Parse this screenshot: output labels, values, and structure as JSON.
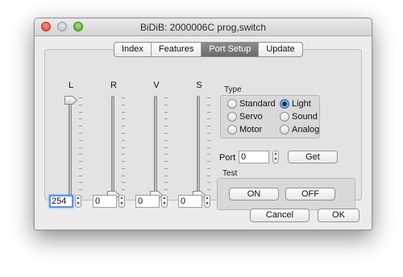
{
  "window": {
    "title": "BiDiB: 2000006C prog,switch"
  },
  "tabs": [
    {
      "label": "Index",
      "active": false
    },
    {
      "label": "Features",
      "active": false
    },
    {
      "label": "Port Setup",
      "active": true
    },
    {
      "label": "Update",
      "active": false
    }
  ],
  "sliders": [
    {
      "label": "L",
      "value": "254",
      "level": 1.0
    },
    {
      "label": "R",
      "value": "0",
      "level": 0.0
    },
    {
      "label": "V",
      "value": "0",
      "level": 0.0
    },
    {
      "label": "S",
      "value": "0",
      "level": 0.0
    }
  ],
  "type_group": {
    "label": "Type",
    "options": [
      {
        "label": "Standard",
        "selected": false
      },
      {
        "label": "Light",
        "selected": true
      },
      {
        "label": "Servo",
        "selected": false
      },
      {
        "label": "Sound",
        "selected": false
      },
      {
        "label": "Motor",
        "selected": false
      },
      {
        "label": "Analog",
        "selected": false
      }
    ]
  },
  "port": {
    "label": "Port",
    "value": "0",
    "get_label": "Get"
  },
  "test_group": {
    "label": "Test",
    "on_label": "ON",
    "off_label": "OFF"
  },
  "footer": {
    "cancel_label": "Cancel",
    "ok_label": "OK"
  },
  "colors": {
    "accent": "#3d7fd9",
    "focus_ring": "#5b95e6"
  }
}
